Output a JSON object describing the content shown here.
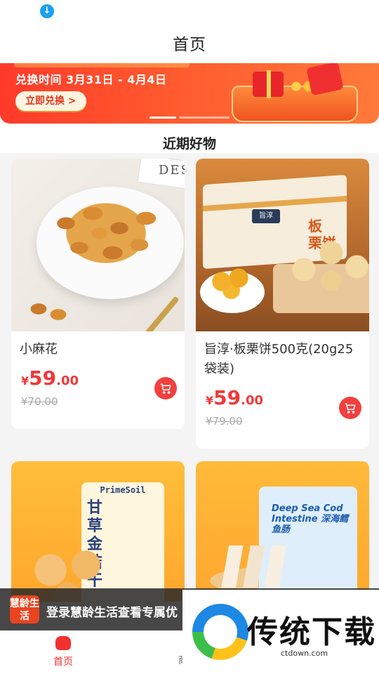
{
  "app": {
    "title": "首页"
  },
  "banner": {
    "exchange_time": "兑换时间 3月31日 - 4月4日",
    "cta_label": "立即兑换 >"
  },
  "section": {
    "title": "近期好物"
  },
  "products": [
    {
      "name": "小麻花",
      "price_yen": "¥",
      "price_int": "59",
      "price_dec": ".00",
      "original_price": "¥70.00",
      "image": "twisted-dough-snack"
    },
    {
      "name": "旨淳·板栗饼500克(20g25袋装)",
      "price_yen": "¥",
      "price_int": "59",
      "price_dec": ".00",
      "original_price": "¥79.00",
      "image": "chestnut-cake-box"
    },
    {
      "name": "",
      "image": "primesoil-snack-bag"
    },
    {
      "name": "",
      "image": "deep-sea-cod-intestine-bag"
    }
  ],
  "product_images": {
    "twists_deco": "DES",
    "box_brand": "旨淳",
    "box_label": "板\n栗饼",
    "bag3_brand": "PrimeSoil",
    "bag3_title": "甘草金桔干",
    "bag4_title": "Deep Sea Cod Intestine 深海鳕鱼肠"
  },
  "login_banner": {
    "logo_text": "慧龄生活",
    "text": "登录慧龄生活查看专属优"
  },
  "bottom_nav": {
    "home_label": "首页",
    "second_label": "商"
  },
  "watermark": {
    "title": "传统下载",
    "url": "ctdown.com"
  },
  "colors": {
    "accent": "#f23030",
    "banner": "#ff4a2a",
    "price": "#f2383a"
  }
}
